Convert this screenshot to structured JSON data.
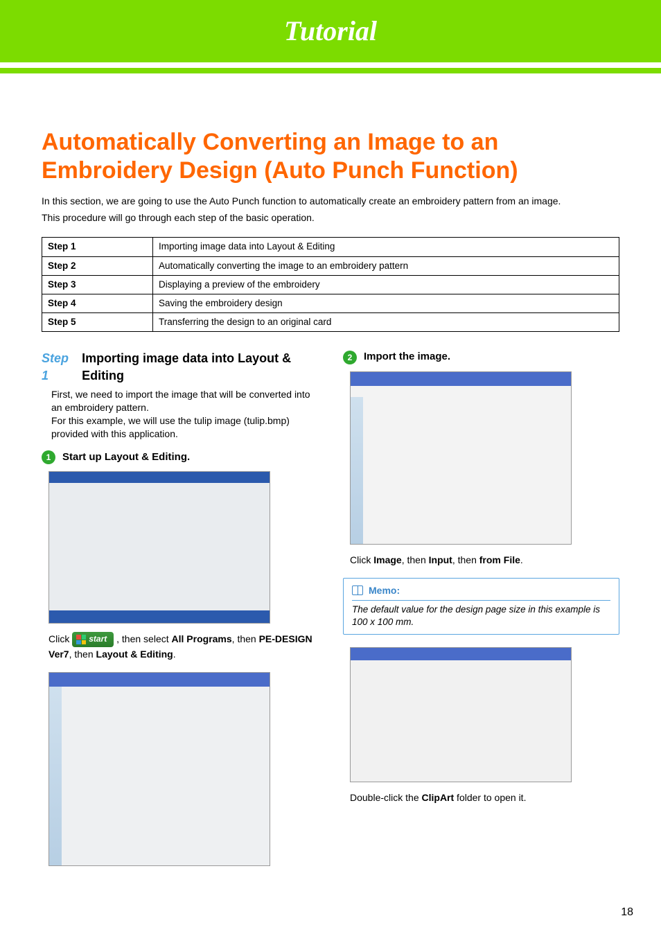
{
  "header": {
    "site_title": "Tutorial"
  },
  "page": {
    "title": "Automatically Converting an Image to an Embroidery Design (Auto Punch Function)",
    "intro1": "In this section, we are going to use the Auto Punch function to automatically create an embroidery pattern from an image.",
    "intro2": "This procedure will go through each step of the basic operation.",
    "page_number": "18"
  },
  "steps_table": [
    {
      "label": "Step 1",
      "desc": "Importing image data into Layout & Editing"
    },
    {
      "label": "Step 2",
      "desc": "Automatically converting the image to an embroidery pattern"
    },
    {
      "label": "Step 3",
      "desc": "Displaying a preview of the embroidery"
    },
    {
      "label": "Step 4",
      "desc": "Saving the embroidery design"
    },
    {
      "label": "Step 5",
      "desc": "Transferring the design to an original card"
    }
  ],
  "left": {
    "step_label": "Step 1",
    "step_title": "Importing image data into Layout & Editing",
    "para1": "First, we need to import the image that will be converted into an embroidery pattern.",
    "para2": "For this example, we will use the tulip image (tulip.bmp) provided with this application.",
    "sub1_num": "1",
    "sub1_text": "Start up Layout & Editing.",
    "start_label": "start",
    "click_pre": "Click ",
    "click_mid": ", then select ",
    "all_programs": "All Programs",
    "then1": ", then ",
    "pe_design": "PE-DESIGN Ver7",
    "layout_editing": "Layout & Editing",
    "period": "."
  },
  "right": {
    "sub2_num": "2",
    "sub2_text": "Import the image.",
    "click2_pre": "Click ",
    "image_word": "Image",
    "then_word": ", then ",
    "input_word": "Input",
    "from_file": "from File",
    "memo_label": "Memo:",
    "memo_body": "The default value for the design page size in this example is 100 x 100 mm.",
    "dbl_pre": "Double-click the ",
    "clipart": "ClipArt",
    "dbl_post": " folder to open it."
  }
}
